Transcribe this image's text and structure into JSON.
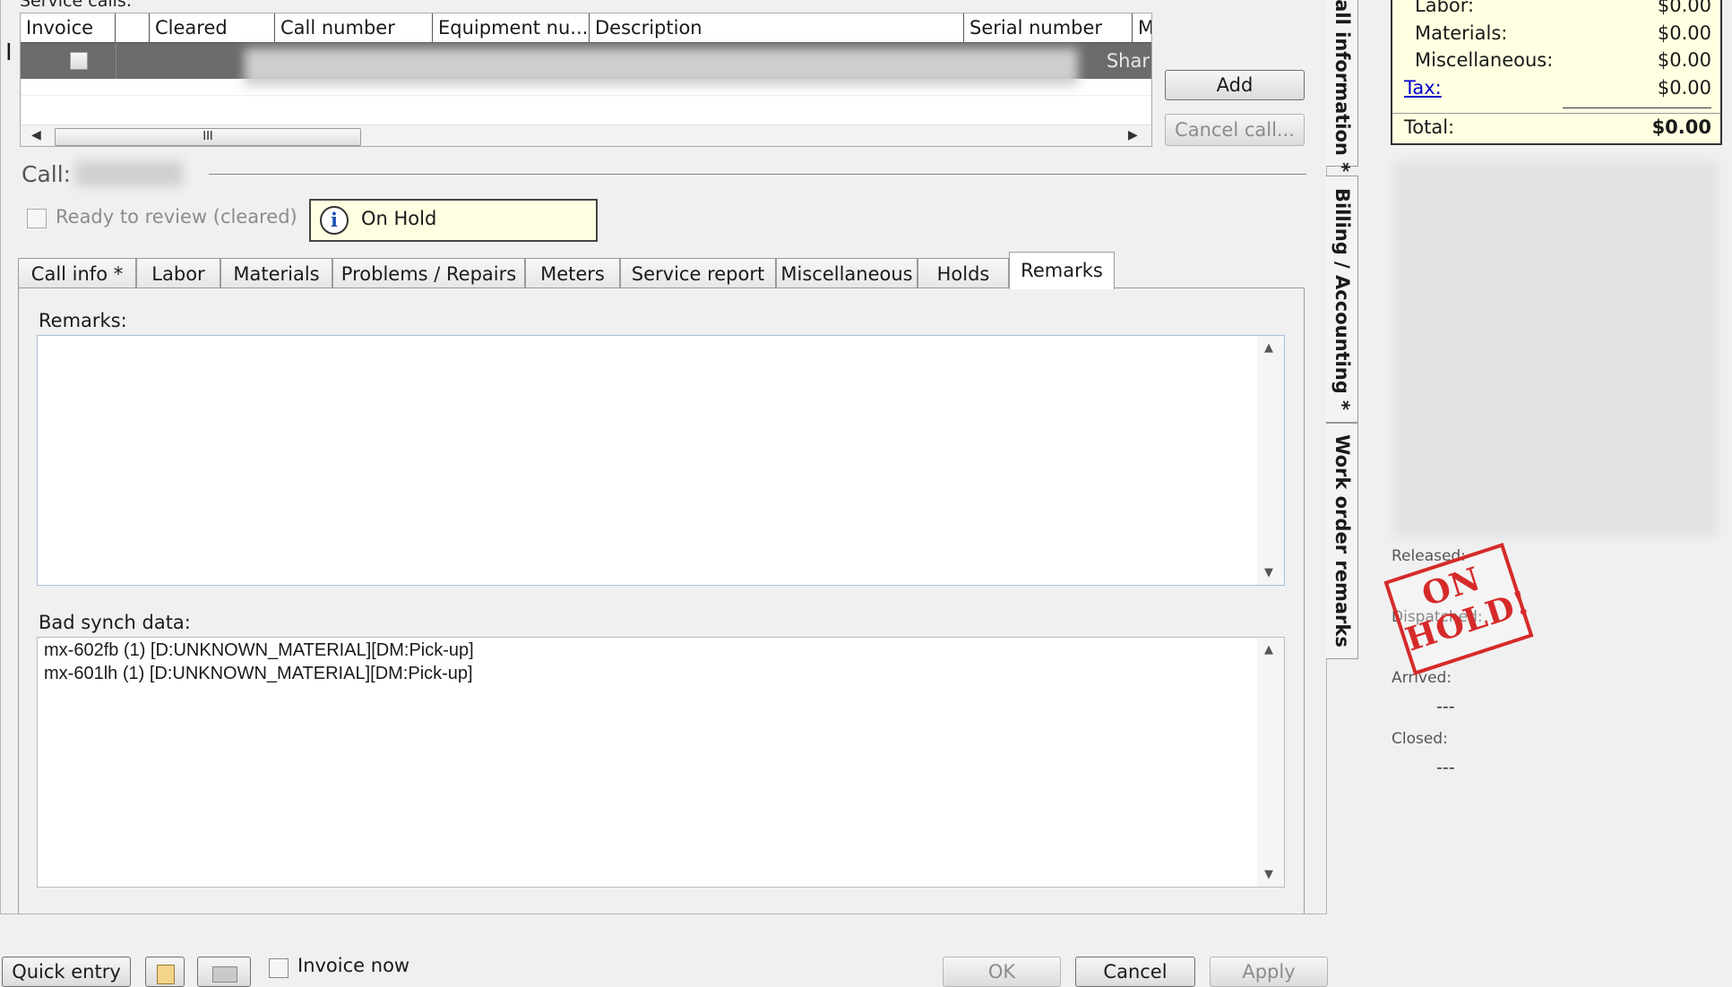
{
  "grid": {
    "section_label": "Service calls:",
    "columns": [
      "Invoice",
      "",
      "Cleared",
      "Call number",
      "Equipment nu...",
      "Description",
      "Serial number",
      "Make"
    ],
    "row_make": "Shar",
    "scroll_grip": "III"
  },
  "buttons": {
    "add": "Add",
    "cancel_call": "Cancel call...",
    "quick_entry": "Quick entry",
    "ok": "OK",
    "cancel": "Cancel",
    "apply": "Apply"
  },
  "call": {
    "label": "Call:",
    "ready_to_review": "Ready to review (cleared)",
    "status": "On Hold",
    "invoice_now": "Invoice now"
  },
  "tabs": [
    "Call info *",
    "Labor",
    "Materials",
    "Problems / Repairs",
    "Meters",
    "Service report",
    "Miscellaneous",
    "Holds",
    "Remarks"
  ],
  "remarks": {
    "label": "Remarks:",
    "value": ""
  },
  "bad_synch": {
    "label": "Bad synch data:",
    "lines": [
      "mx-602fb (1) [D:UNKNOWN_MATERIAL][DM:Pick-up]",
      "mx-601lh (1) [D:UNKNOWN_MATERIAL][DM:Pick-up]"
    ]
  },
  "side_tabs": [
    "Call information *",
    "Billing / Accounting *",
    "Work order remarks"
  ],
  "summary": {
    "labor_label": "Labor:",
    "labor_value": "$0.00",
    "materials_label": "Materials:",
    "materials_value": "$0.00",
    "misc_label": "Miscellaneous:",
    "misc_value": "$0.00",
    "tax_label": "Tax:",
    "tax_value": "$0.00",
    "total_label": "Total:",
    "total_value": "$0.00"
  },
  "timeline": {
    "released_label": "Released:",
    "dispatched_label": "Dispatched:",
    "arrived_label": "Arrived:",
    "arrived_value": "---",
    "closed_label": "Closed:",
    "closed_value": "---"
  },
  "stamp": {
    "line1": "ON",
    "line2": "HOLD!"
  },
  "colors": {
    "status_bg": "#ffffe1",
    "stamp": "#d62a2a",
    "link": "#0000cc"
  }
}
